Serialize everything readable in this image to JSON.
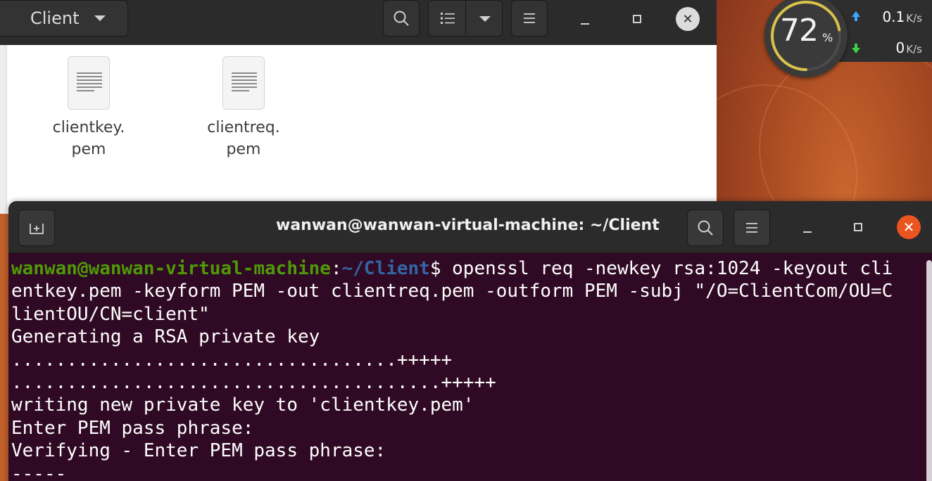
{
  "file_manager": {
    "path_button": "Client",
    "icons": {
      "path_caret": "chevron-down-icon",
      "search": "search-icon",
      "view_list": "list-view-icon",
      "view_caret": "chevron-down-icon",
      "menu": "hamburger-menu-icon",
      "minimize": "minimize-icon",
      "maximize": "maximize-icon",
      "close": "close-icon"
    },
    "files": [
      {
        "name_line1": "clientkey.",
        "name_line2": "pem"
      },
      {
        "name_line1": "clientreq.",
        "name_line2": "pem"
      }
    ]
  },
  "system_monitor": {
    "cpu_percent": "72",
    "cpu_unit": "%",
    "cpu_fraction": 0.72,
    "upload_value": "0.1",
    "upload_unit": "K/s",
    "download_value": "0",
    "download_unit": "K/s"
  },
  "terminal": {
    "title": "wanwan@wanwan-virtual-machine: ~/Client",
    "colors": {
      "background": "#300a24",
      "prompt_user": "#4e9a06",
      "prompt_path": "#3465a4",
      "close": "#e95420"
    },
    "prompt_user": "wanwan@wanwan-virtual-machine",
    "prompt_sep": ":",
    "prompt_path": "~/Client",
    "prompt_end": "$ ",
    "command_line1": "openssl req -newkey rsa:1024 -keyout cli",
    "lines": [
      "entkey.pem -keyform PEM -out clientreq.pem -outform PEM -subj \"/O=ClientCom/OU=C",
      "lientOU/CN=client\"",
      "Generating a RSA private key",
      "...................................+++++",
      ".......................................+++++",
      "writing new private key to 'clientkey.pem'",
      "Enter PEM pass phrase:",
      "Verifying - Enter PEM pass phrase:",
      "-----"
    ]
  }
}
